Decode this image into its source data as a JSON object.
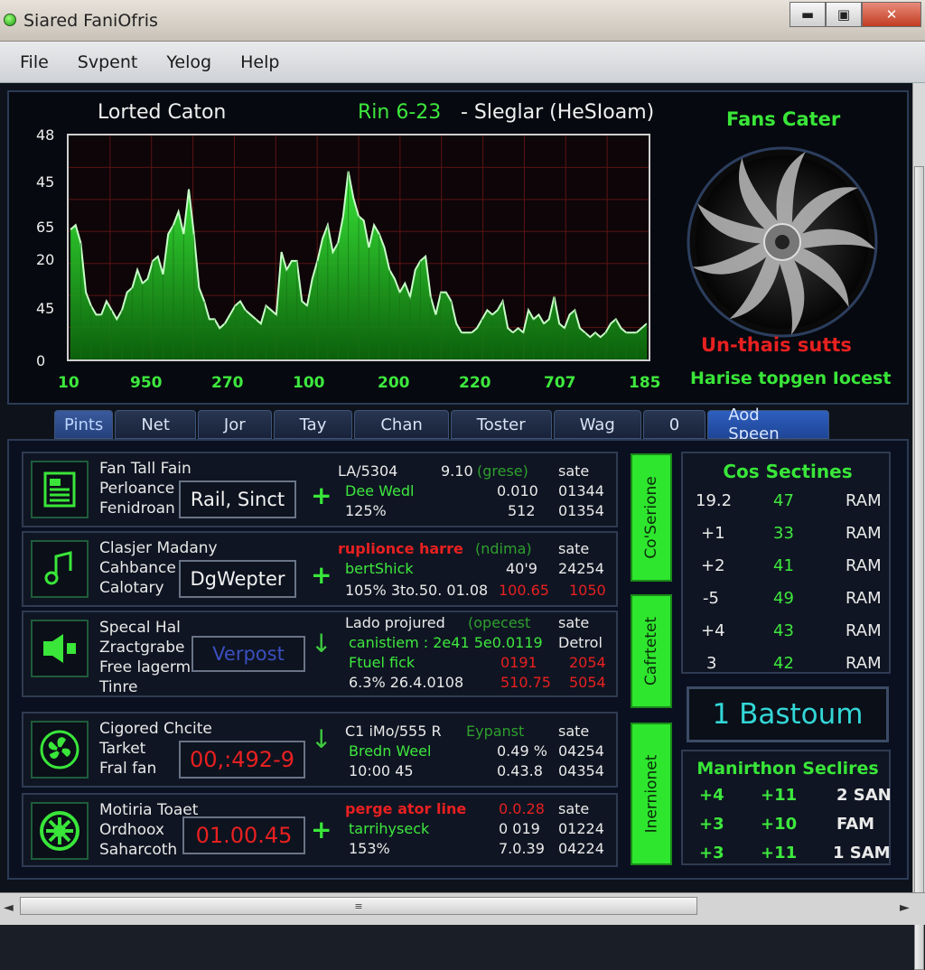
{
  "window": {
    "title": "Siared FaniOfris",
    "controls": {
      "minimize": "▬",
      "maximize": "▣",
      "close": "✕"
    }
  },
  "menu": [
    "File",
    "Svpent",
    "Yelog",
    "Help"
  ],
  "chart": {
    "title": "Lorted Caton",
    "subtitle_green": "Rin 6-23",
    "subtitle_white": "- Sleglar (HeSIoam)",
    "y_ticks": [
      "48",
      "45",
      "65",
      "20",
      "45",
      "0"
    ],
    "x_ticks": [
      "10",
      "950",
      "270",
      "100",
      "200",
      "220",
      "707",
      "185"
    ]
  },
  "chart_data": {
    "type": "area",
    "title": "Lorted Caton",
    "color": "#2ad62a",
    "values": [
      58,
      60,
      52,
      30,
      24,
      20,
      20,
      26,
      22,
      18,
      22,
      30,
      32,
      40,
      34,
      36,
      44,
      46,
      38,
      56,
      60,
      66,
      56,
      76,
      56,
      32,
      26,
      18,
      18,
      14,
      16,
      20,
      24,
      26,
      22,
      20,
      18,
      16,
      24,
      22,
      20,
      48,
      40,
      44,
      44,
      26,
      24,
      36,
      44,
      54,
      60,
      48,
      52,
      64,
      84,
      72,
      64,
      62,
      50,
      60,
      56,
      50,
      40,
      36,
      30,
      34,
      28,
      40,
      44,
      46,
      28,
      20,
      30,
      30,
      26,
      16,
      12,
      12,
      12,
      14,
      18,
      22,
      20,
      22,
      26,
      14,
      12,
      14,
      12,
      22,
      18,
      20,
      16,
      18,
      28,
      16,
      14,
      20,
      22,
      14,
      12,
      10,
      12,
      10,
      12,
      16,
      18,
      14,
      12,
      12,
      12,
      14,
      16
    ]
  },
  "fan": {
    "title": "Fans Cater",
    "status_red": "Un-thais sutts",
    "status_green": "Harise topgen Iocest"
  },
  "tabs": [
    "Pints",
    "Net",
    "Jor",
    "Tay",
    "Chan",
    "Toster",
    "Wag",
    "0",
    "Aod Speen"
  ],
  "rows": [
    {
      "icon": "document-icon",
      "labels": [
        "Fan Tall Fain",
        "Perloance",
        "Fenidroan"
      ],
      "box": "Rail, Sinct",
      "box_style": "",
      "arrow": "+",
      "col1": [
        "LA/5304",
        "Dee Wedl",
        "125%"
      ],
      "col2": [
        "9.10",
        "0.010",
        "512"
      ],
      "col2b": "(grese)",
      "col3": [
        "sate",
        "01344",
        "01354"
      ]
    },
    {
      "icon": "music-note-icon",
      "labels": [
        "Clasjer Madany",
        "Cahbance",
        "Calotary"
      ],
      "box": "DgWepter",
      "box_style": "",
      "arrow": "+",
      "col1": [
        "ruplionce harre",
        "bertShick",
        "105% 3to.50. 01.08"
      ],
      "col2": [
        "(ndima)",
        "40'9",
        "100.65"
      ],
      "col3": [
        "sate",
        "24254",
        "1050"
      ]
    },
    {
      "icon": "speaker-icon",
      "labels": [
        "Specal Hal",
        "Zractgrabe",
        "Free lagerm",
        "Tinre"
      ],
      "box": "Verpost",
      "box_style": "blue",
      "arrow": "↓",
      "col1": [
        "Lado projured",
        "canistiem : 2e41 5e0.0119",
        "Ftuel fick",
        "6.3% 26.4.0108"
      ],
      "col2": [
        "(opecest",
        "0191",
        "510.75"
      ],
      "col3": [
        "sate",
        "Detrol",
        "2054",
        "5054"
      ]
    },
    {
      "icon": "fan-icon",
      "labels": [
        "Cigored Chcite",
        "Tarket",
        "Fral fan"
      ],
      "box": "00,:492-9",
      "box_style": "red",
      "arrow": "↓",
      "col1": [
        "C1 iMo/555 R",
        "Bredn Weel",
        "10:00 45"
      ],
      "col2": [
        "Eypanst",
        "0.49 %",
        "0.43.8"
      ],
      "col3": [
        "sate",
        "04254",
        "04354"
      ]
    },
    {
      "icon": "gear-fan-icon",
      "labels": [
        "Motiria Toaet",
        "Ordhoox",
        "Saharcoth"
      ],
      "box": "01.00.45",
      "box_style": "red",
      "arrow": "+",
      "col1": [
        "perge ator line",
        "tarrihyseck",
        "153%"
      ],
      "col2": [
        "0.0.28",
        "0 019",
        "7.0.39"
      ],
      "col3": [
        "sate",
        "01224",
        "04224"
      ]
    }
  ],
  "side_buttons": [
    "Co'Serione",
    "Cafrtetet",
    "Inernionet"
  ],
  "cos": {
    "title": "Cos Sectines",
    "rows": [
      [
        "19.2",
        "47",
        "RAM"
      ],
      [
        "+1",
        "33",
        "RAM"
      ],
      [
        "+2",
        "41",
        "RAM"
      ],
      [
        "-5",
        "49",
        "RAM"
      ],
      [
        "+4",
        "43",
        "RAM"
      ],
      [
        "3",
        "42",
        "RAM"
      ]
    ]
  },
  "bast": "1 Bastoum",
  "man": {
    "title": "Manirthon Seclires",
    "rows": [
      [
        "+4",
        "+11",
        "2 SAN"
      ],
      [
        "+3",
        "+10",
        "FAM"
      ],
      [
        "+3",
        "+11",
        "1 SAM"
      ]
    ]
  },
  "hscroll": {
    "left": "◄",
    "right": "►",
    "grip": "≡"
  }
}
